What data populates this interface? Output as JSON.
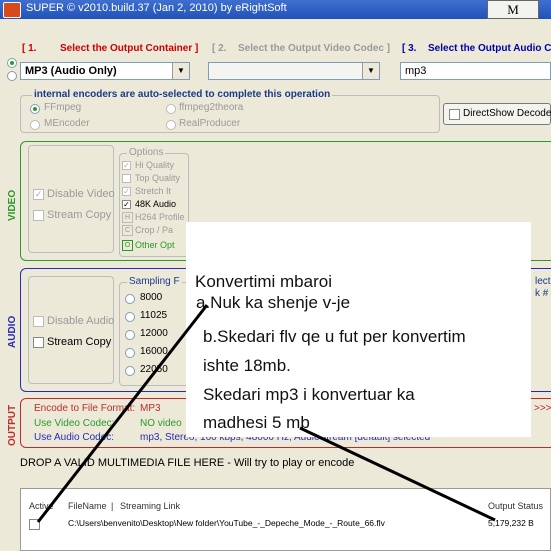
{
  "titlebar": {
    "title": "SUPER © v2010.build.37 (Jan 2, 2010) by eRightSoft",
    "m_button": "M"
  },
  "sections": {
    "s1_num": "[ 1.",
    "s1_label": "Select the Output Container ]",
    "s2_num": "[ 2.",
    "s2_label": "Select the Output Video Codec ]",
    "s3_num": "[ 3.",
    "s3_label": "Select the Output Audio Co"
  },
  "container": {
    "value": "MP3      (Audio Only)"
  },
  "audio_codec": {
    "value": "mp3"
  },
  "encoders": {
    "caption": "internal encoders are auto-selected to complete this operation",
    "ffmpeg": "FFmpeg",
    "mencoder": "MEncoder",
    "ffmpeg2theora": "ffmpeg2theora",
    "realproducer": "RealProducer"
  },
  "directshow": {
    "label": "DirectShow Decode"
  },
  "video": {
    "side_label": "VIDEO",
    "disable_video": "Disable Video",
    "stream_copy": "Stream Copy",
    "options_title": "Options",
    "options": [
      "Hi Quality",
      "Top Quality",
      "Stretch It",
      "48K Audio",
      "Crop / Pa",
      "Other Opt"
    ],
    "h264": "H264 Profile",
    "marks": [
      "H",
      "C",
      "O"
    ]
  },
  "audio": {
    "side_label": "AUDIO",
    "disable_audio": "Disable Audio",
    "stream_copy": "Stream Copy",
    "sampling_title": "Sampling F",
    "rates": [
      "8000",
      "11025",
      "12000",
      "16000",
      "22050"
    ],
    "right_a": "lect",
    "right_b": "k #"
  },
  "output": {
    "side_label": "OUTPUT",
    "encode_label": "Encode to File Format:",
    "encode_value": "MP3",
    "video_label": "Use Video Codec:",
    "video_value": "NO video",
    "audio_label": "Use Audio Codec:",
    "audio_value": "mp3,   Stereo,   160 kbps,   48000 Hz,   AudioStream [default] selected",
    "arrows": ">>>"
  },
  "drop_hint": "DROP A VALID MULTIMEDIA FILE HERE - Will try to play or encode",
  "file_table": {
    "headers": {
      "active": "Active",
      "filename": "FileName",
      "sep": "|",
      "link": "Streaming Link",
      "status": "Output Status"
    },
    "rows": [
      {
        "path": "C:\\Users\\benvenito\\Desktop\\New folder\\YouTube_-_Depeche_Mode_-_Route_66.flv",
        "status": "5,179,232 B"
      }
    ]
  },
  "annotation": {
    "line1": "Konvertimi mbaroi",
    "line2": "a.Nuk ka shenje v-je",
    "line3": "b.Skedari flv qe u fut per konvertim",
    "line4": "ishte 18mb.",
    "line5": "Skedari mp3  i konvertuar ka",
    "line6": "madhesi 5 mb"
  },
  "colors": {
    "video": "#2a9a2a",
    "audio": "#2a2ab8",
    "output": "#c22a2a",
    "title": "#2152b8"
  }
}
